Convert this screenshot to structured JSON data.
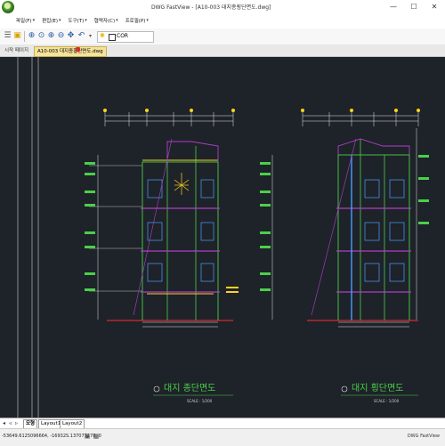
{
  "window": {
    "title": "DWG FastView - [A10-003 대지종횡단면도.dwg]",
    "minimize": "—",
    "maximize": "☐",
    "close": "✕"
  },
  "menu": {
    "items": [
      {
        "label": "파일(F)"
      },
      {
        "label": "편집(E)"
      },
      {
        "label": "도구(T)"
      },
      {
        "label": "협력자(C)"
      },
      {
        "label": "프로필(P)"
      }
    ]
  },
  "toolbar": {
    "layer": "COR"
  },
  "tabs": {
    "start": "시작 페이지",
    "drawing": "A10-003 대지종횡단면도.dwg"
  },
  "drawing": {
    "left_title": "대지 종단면도",
    "left_scale": "SCALE : 1/200",
    "right_title": "대지 횡단면도",
    "right_scale": "SCALE : 1/200",
    "colors": {
      "background": "#1e2229",
      "structure": "#4ad04a",
      "dimension": "#e8e8e8",
      "grid": "#b040c8",
      "accent": "#ffd21e",
      "ground": "#ff3030",
      "window": "#4aa0ff"
    }
  },
  "layout_tabs": {
    "model": "모형",
    "layout1": "Layout1",
    "layout2": "Layout2"
  },
  "status": {
    "coords": "-53649.6125096664, -16932S.137077178, 0",
    "app": "DWG FastView"
  }
}
